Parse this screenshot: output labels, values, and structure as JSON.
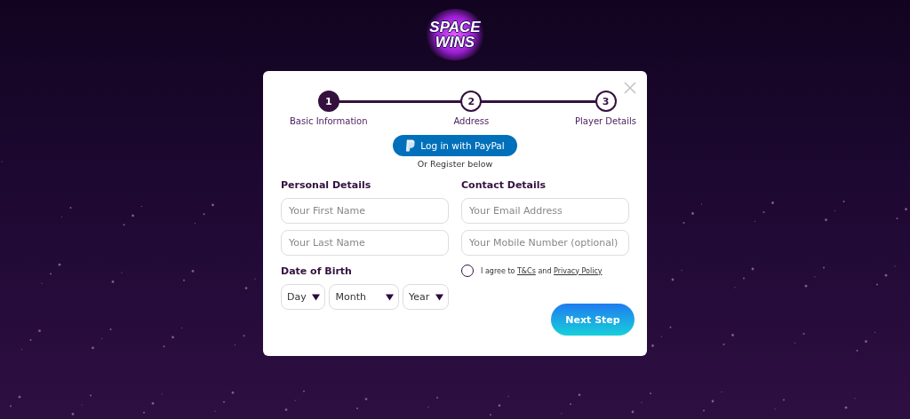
{
  "logo": {
    "lines": [
      "SPACE",
      "WINS"
    ]
  },
  "steps": [
    {
      "number": "1",
      "label": "Basic Information",
      "selected": true
    },
    {
      "number": "2",
      "label": "Address",
      "selected": false
    },
    {
      "number": "3",
      "label": "Player Details",
      "selected": false
    }
  ],
  "paypal": {
    "label": "Log in with PayPal"
  },
  "register_hint": "Or Register below",
  "personal": {
    "heading": "Personal Details",
    "fields": [
      {
        "placeholder": "Your First Name"
      },
      {
        "placeholder": "Your Last Name"
      }
    ]
  },
  "dob": {
    "heading": "Date of Birth",
    "selects": [
      {
        "value": "Day"
      },
      {
        "value": "Month"
      },
      {
        "value": "Year"
      }
    ]
  },
  "contact": {
    "heading": "Contact Details",
    "fields": [
      {
        "placeholder": "Your Email Address"
      },
      {
        "placeholder": "Your Mobile Number (optional)"
      }
    ]
  },
  "agree": {
    "checked": false,
    "parts": [
      {
        "kind": "text",
        "text": "I agree to "
      },
      {
        "kind": "link",
        "text": "T&Cs"
      },
      {
        "kind": "text",
        "text": " and "
      },
      {
        "kind": "link",
        "text": "Privacy Policy"
      }
    ]
  },
  "next_button": "Next Step"
}
